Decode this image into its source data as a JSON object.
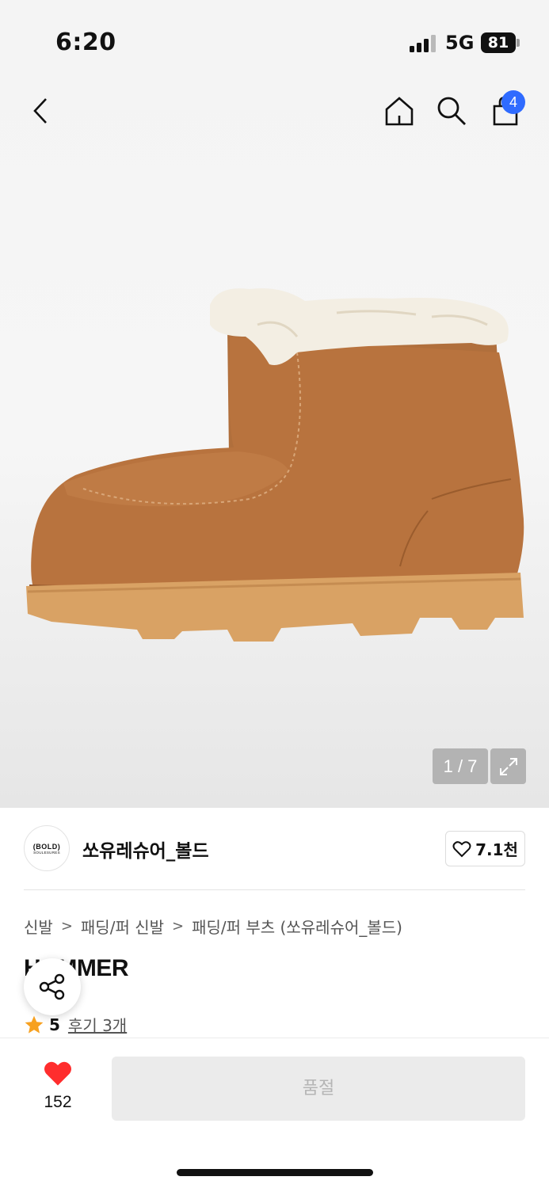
{
  "status_bar": {
    "time": "6:20",
    "network": "5G",
    "battery": "81"
  },
  "nav": {
    "back_icon": "chevron-left-icon",
    "home_icon": "home-icon",
    "search_icon": "search-icon",
    "cart_icon": "shopping-bag-icon",
    "cart_count": "4"
  },
  "gallery": {
    "counter": "1 / 7",
    "expand_icon": "expand-icon"
  },
  "brand": {
    "logo_line1": "(BOLD)",
    "logo_line2": "SOULESURES",
    "name": "쏘유레슈어_볼드",
    "likes": "7.1천"
  },
  "breadcrumb": [
    "신발",
    "패딩/퍼 신발",
    "패딩/퍼 부츠 (쏘유레슈어_볼드)"
  ],
  "product": {
    "name": "HAMMER",
    "rating": "5",
    "reviews": "후기 3개"
  },
  "bottom_bar": {
    "wish_count": "152",
    "buy_label": "품절"
  },
  "colors": {
    "accent": "#2f6bff",
    "heart": "#ff2d2d",
    "star": "#f7a120",
    "suede": "#b8733e",
    "sole": "#d9a264",
    "fur": "#f3eee3"
  }
}
